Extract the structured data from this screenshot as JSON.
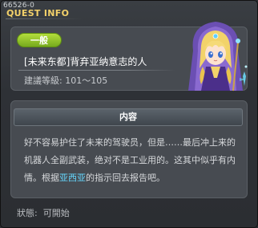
{
  "window": {
    "id_text": "66526-0",
    "title": "QUEST INFO"
  },
  "quest": {
    "category": "一般",
    "name": "[未来东都]背弃亚纳意志的人",
    "level_label": "建議等級",
    "level_range": "101～105"
  },
  "content": {
    "section_title": "内容",
    "description_before": "好不容易护住了未来的驾驶员，但是……最后冲上来的机器人全副武装，绝对不是工业用的。这其中似乎有内情。根据",
    "description_highlight": "亚西亚",
    "description_after": "的指示回去报告吧。"
  },
  "status": {
    "label": "狀態",
    "value": "可開始"
  },
  "colors": {
    "title": "#f3d16a",
    "badge_green": "#8cc42a",
    "highlight": "#66d8ff"
  },
  "icons": {
    "portrait": "npc-portrait-mage-girl"
  }
}
